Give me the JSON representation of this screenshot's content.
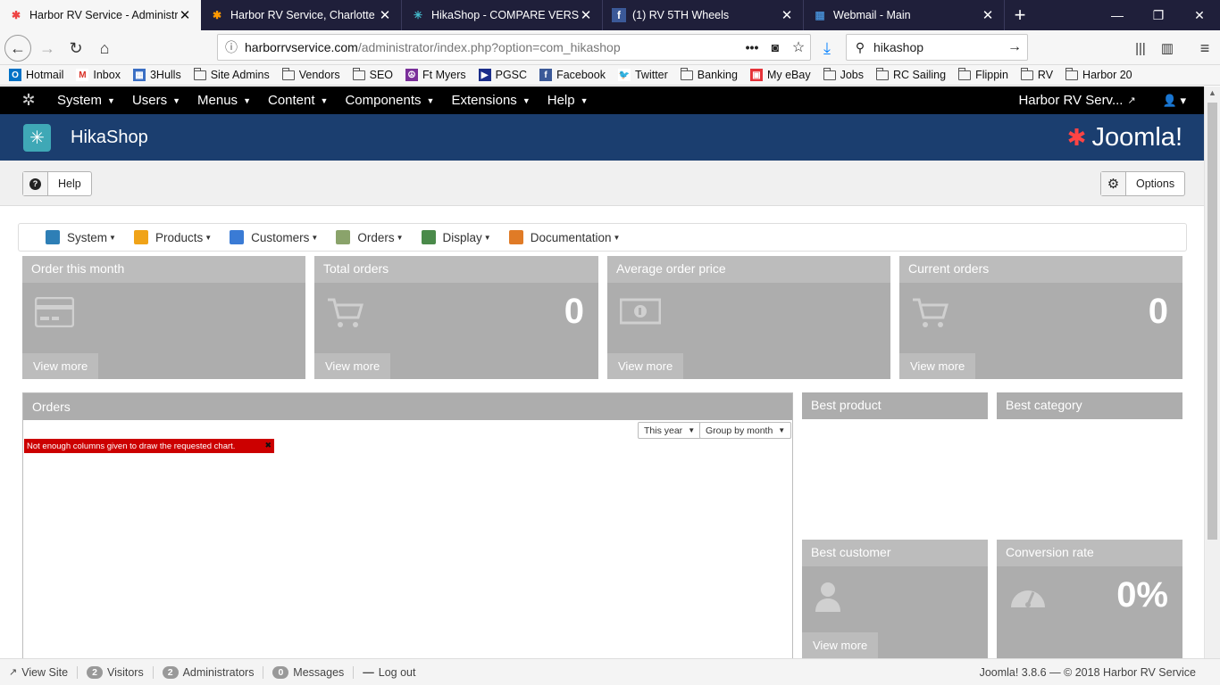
{
  "browser": {
    "tabs": [
      {
        "title": "Harbor RV Service - Administra",
        "icon": "joomla-favicon",
        "active": true
      },
      {
        "title": "Harbor RV Service, Charlotte H",
        "icon": "joomla-favicon",
        "active": false
      },
      {
        "title": "HikaShop - COMPARE VERSION",
        "icon": "hikashop-favicon",
        "active": false
      },
      {
        "title": "(1) RV 5TH Wheels",
        "icon": "facebook-favicon",
        "active": false
      },
      {
        "title": "Webmail - Main",
        "icon": "webmail-favicon",
        "active": false
      }
    ],
    "url": "harborrvservice.com/administrator/index.php?option=com_hikashop",
    "url_domain": "harborrvservice.com",
    "url_path": "/administrator/index.php?option=com_hikashop",
    "search_value": "hikashop",
    "bookmarks": [
      {
        "label": "Hotmail",
        "icon": "outlook-icon"
      },
      {
        "label": "Inbox",
        "icon": "gmail-icon"
      },
      {
        "label": "3Hulls",
        "icon": "grid-icon"
      },
      {
        "label": "Site Admins",
        "icon": "folder-icon"
      },
      {
        "label": "Vendors",
        "icon": "folder-icon"
      },
      {
        "label": "SEO",
        "icon": "folder-icon"
      },
      {
        "label": "Ft Myers",
        "icon": "peace-icon"
      },
      {
        "label": "PGSC",
        "icon": "flag-icon"
      },
      {
        "label": "Facebook",
        "icon": "facebook-icon"
      },
      {
        "label": "Twitter",
        "icon": "twitter-icon"
      },
      {
        "label": "Banking",
        "icon": "folder-icon"
      },
      {
        "label": "My eBay",
        "icon": "ebay-icon"
      },
      {
        "label": "Jobs",
        "icon": "folder-icon"
      },
      {
        "label": "RC Sailing",
        "icon": "folder-icon"
      },
      {
        "label": "Flippin",
        "icon": "folder-icon"
      },
      {
        "label": "RV",
        "icon": "folder-icon"
      },
      {
        "label": "Harbor 20",
        "icon": "folder-icon"
      }
    ]
  },
  "joomla": {
    "menu": [
      "System",
      "Users",
      "Menus",
      "Content",
      "Components",
      "Extensions",
      "Help"
    ],
    "site_link": "Harbor RV Serv...",
    "component_title": "HikaShop",
    "logo_text": "Joomla!",
    "toolbar": {
      "help_label": "Help",
      "options_label": "Options"
    }
  },
  "hikashop": {
    "menu": [
      {
        "label": "System",
        "color": "#2e7fb6"
      },
      {
        "label": "Products",
        "color": "#f0a318"
      },
      {
        "label": "Customers",
        "color": "#3a7bd5"
      },
      {
        "label": "Orders",
        "color": "#8aa36b"
      },
      {
        "label": "Display",
        "color": "#4a8a4a"
      },
      {
        "label": "Documentation",
        "color": "#e07b26"
      }
    ],
    "cards": [
      {
        "title": "Order this month",
        "value": "",
        "icon": "credit-card-icon",
        "more": "View more"
      },
      {
        "title": "Total orders",
        "value": "0",
        "icon": "cart-icon",
        "more": "View more"
      },
      {
        "title": "Average order price",
        "value": "",
        "icon": "money-icon",
        "more": "View more"
      },
      {
        "title": "Current orders",
        "value": "0",
        "icon": "cart-icon",
        "more": "View more"
      }
    ],
    "orders": {
      "title": "Orders",
      "period": "This year",
      "group": "Group by month",
      "error": "Not enough columns given to draw the requested chart."
    },
    "best_product": {
      "title": "Best product"
    },
    "best_category": {
      "title": "Best category"
    },
    "best_customer": {
      "title": "Best customer",
      "more": "View more"
    },
    "conversion": {
      "title": "Conversion rate",
      "value": "0%"
    }
  },
  "status": {
    "view_site": "View Site",
    "visitors_count": "2",
    "visitors_label": "Visitors",
    "admins_count": "2",
    "admins_label": "Administrators",
    "messages_count": "0",
    "messages_label": "Messages",
    "logout": "Log out",
    "version": "Joomla! 3.8.6 — © 2018 Harbor RV Service"
  }
}
